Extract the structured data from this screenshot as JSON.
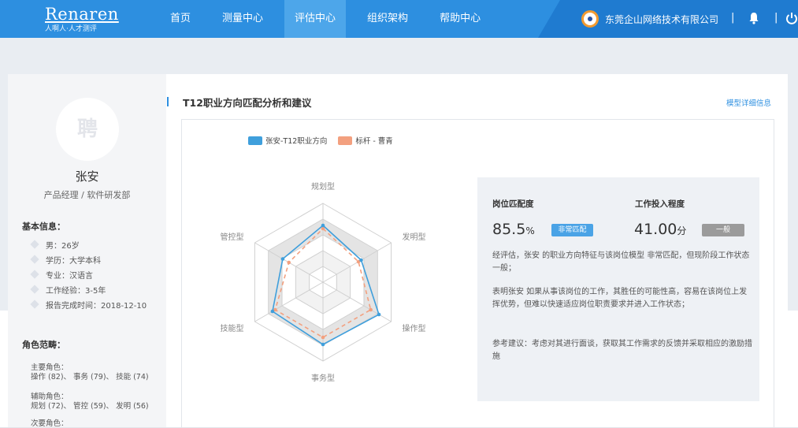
{
  "header": {
    "logo_main": "Renaren",
    "logo_sub": "人啊人·人才测评",
    "nav": [
      "首页",
      "测量中心",
      "评估中心",
      "组织架构",
      "帮助中心"
    ],
    "active_nav": "评估中心",
    "company": "东莞企山网络技术有限公司",
    "separator": "|"
  },
  "profile": {
    "avatar_text": "聘",
    "name": "张安",
    "role": "产品经理 / 软件研发部",
    "basic_title": "基本信息：",
    "info": [
      "男：26岁",
      "学历：大学本科",
      "专业：汉语言",
      "工作经验：3-5年",
      "报告完成时间：2018-12-10"
    ],
    "roles_title": "角色范畴：",
    "primary_label": "主要角色：",
    "primary_value": "操作 (82)、 事务 (79)、 技能 (74)",
    "secondary_label": "辅助角色：",
    "secondary_value": "规划 (72)、 管控 (59)、 发明 (56)",
    "minor_label": "次要角色："
  },
  "main": {
    "title": "T12职业方向匹配分析和建议",
    "detail_link": "模型详细信息"
  },
  "chart_data": {
    "type": "radar",
    "axes": [
      "规划型",
      "发明型",
      "操作型",
      "事务型",
      "技能型",
      "管控型"
    ],
    "series": [
      {
        "name": "张安-T12职业方向",
        "color": "#3f9fdc",
        "values": [
          72,
          56,
          82,
          79,
          74,
          59
        ]
      },
      {
        "name": "标杆 - 曹青",
        "color": "#f3a07f",
        "values": [
          68,
          52,
          70,
          70,
          70,
          50
        ]
      }
    ],
    "range": [
      0,
      100
    ]
  },
  "analysis": {
    "match_label": "岗位匹配度",
    "match_value": "85.5",
    "match_unit": "%",
    "match_badge": "非常匹配",
    "match_badge_color": "#4aa3e6",
    "engage_label": "工作投入程度",
    "engage_value": "41.00",
    "engage_unit": "分",
    "engage_badge": "一般",
    "engage_badge_color": "#9b9b9b",
    "para1": "经评估，张安 的职业方向特征与该岗位模型 非常匹配，但现阶段工作状态 一般；",
    "para2": "表明张安 如果从事该岗位的工作，其胜任的可能性高，容易在该岗位上发挥优势，但难以快速适应岗位职责要求并进入工作状态；",
    "para3": "参考建议：考虑对其进行面谈，获取其工作需求的反馈并采取相应的激励措施"
  }
}
